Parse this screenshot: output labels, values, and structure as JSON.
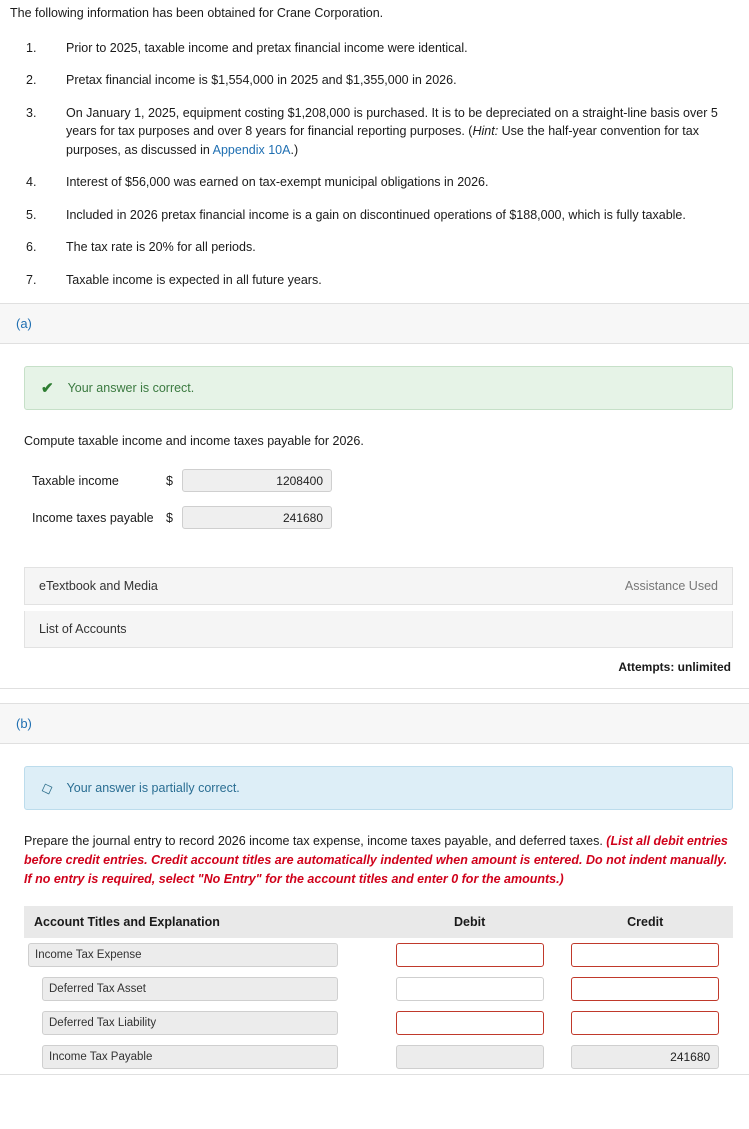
{
  "intro": "The following information has been obtained for Crane Corporation.",
  "facts": [
    {
      "num": "1.",
      "parts": [
        {
          "t": "Prior to 2025, taxable income and pretax financial income were identical."
        }
      ]
    },
    {
      "num": "2.",
      "parts": [
        {
          "t": "Pretax financial income is $1,554,000 in 2025 and $1,355,000 in 2026."
        }
      ]
    },
    {
      "num": "3.",
      "parts": [
        {
          "t": "On January 1, 2025, equipment costing $1,208,000 is purchased. It is to be depreciated on a straight-line basis over 5 years for tax purposes and over 8 years for financial reporting purposes. ("
        },
        {
          "t": "Hint:",
          "style": "italic"
        },
        {
          "t": " Use the half-year convention for tax purposes, as discussed in "
        },
        {
          "t": "Appendix 10A",
          "style": "link"
        },
        {
          "t": ".)"
        }
      ]
    },
    {
      "num": "4.",
      "parts": [
        {
          "t": "Interest of $56,000 was earned on tax-exempt municipal obligations in 2026."
        }
      ]
    },
    {
      "num": "5.",
      "parts": [
        {
          "t": "Included in 2026 pretax financial income is a gain on discontinued operations of $188,000, which is fully taxable."
        }
      ]
    },
    {
      "num": "6.",
      "parts": [
        {
          "t": "The tax rate is 20% for all periods."
        }
      ]
    },
    {
      "num": "7.",
      "parts": [
        {
          "t": "Taxable income is expected in all future years."
        }
      ]
    }
  ],
  "part_a": {
    "label": "(a)",
    "alert": "Your answer is correct.",
    "alert_icon": "check-icon",
    "prompt": "Compute taxable income and income taxes payable for 2026.",
    "rows": [
      {
        "label": "Taxable income",
        "currency": "$",
        "value": "1208400"
      },
      {
        "label": "Income taxes payable",
        "currency": "$",
        "value": "241680"
      }
    ],
    "etextbook_label": "eTextbook and Media",
    "assistance_label": "Assistance Used",
    "accounts_label": "List of Accounts",
    "attempts": "Attempts: unlimited"
  },
  "part_b": {
    "label": "(b)",
    "alert": "Your answer is partially correct.",
    "alert_icon": "partial-icon",
    "prompt_plain": "Prepare the journal entry to record 2026 income tax expense, income taxes payable, and deferred taxes. ",
    "prompt_red": "(List all debit entries before credit entries. Credit account titles are automatically indented when amount is entered. Do not indent manually. If no entry is required, select \"No Entry\" for the account titles and enter 0 for the amounts.)",
    "table": {
      "headers": [
        "Account Titles and Explanation",
        "Debit",
        "Credit"
      ],
      "rows": [
        {
          "account": "Income Tax Expense",
          "indent": false,
          "debit": "",
          "credit": "",
          "debit_state": "error",
          "credit_state": "error"
        },
        {
          "account": "Deferred Tax Asset",
          "indent": true,
          "debit": "",
          "credit": "",
          "debit_state": "normal",
          "credit_state": "error"
        },
        {
          "account": "Deferred Tax Liability",
          "indent": true,
          "debit": "",
          "credit": "",
          "debit_state": "error",
          "credit_state": "error"
        },
        {
          "account": "Income Tax Payable",
          "indent": true,
          "debit": "",
          "credit": "241680",
          "debit_state": "filled",
          "credit_state": "filled"
        }
      ]
    }
  }
}
